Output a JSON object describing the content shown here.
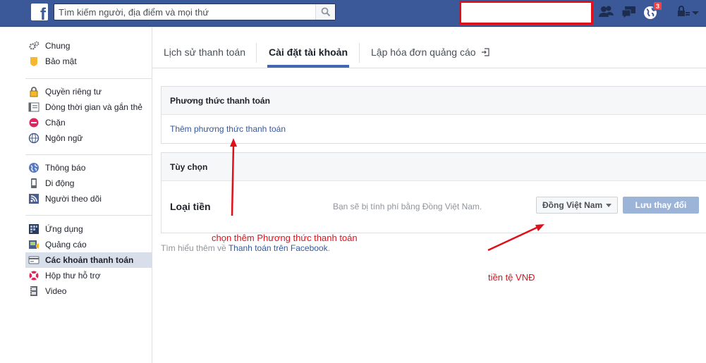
{
  "topbar": {
    "logo": "f",
    "search_placeholder": "Tìm kiếm người, địa điểm và mọi thứ",
    "notifications_badge": "3",
    "icons": [
      "friend-requests-icon",
      "messages-icon",
      "notifications-globe-icon",
      "privacy-shortcuts-icon",
      "account-menu-chevron-icon"
    ]
  },
  "leftnav": {
    "groups": [
      [
        {
          "label": "Chung",
          "icon": "gears-icon"
        },
        {
          "label": "Bảo mật",
          "icon": "shield-badge-icon"
        }
      ],
      [
        {
          "label": "Quyền riêng tư",
          "icon": "lock-icon"
        },
        {
          "label": "Dòng thời gian và gắn thẻ",
          "icon": "timeline-icon"
        },
        {
          "label": "Chặn",
          "icon": "block-icon"
        },
        {
          "label": "Ngôn ngữ",
          "icon": "globe-icon"
        }
      ],
      [
        {
          "label": "Thông báo",
          "icon": "globe-notifications-icon"
        },
        {
          "label": "Di động",
          "icon": "mobile-icon"
        },
        {
          "label": "Người theo dõi",
          "icon": "rss-icon"
        }
      ],
      [
        {
          "label": "Ứng dụng",
          "icon": "apps-grid-icon"
        },
        {
          "label": "Quảng cáo",
          "icon": "ads-icon"
        },
        {
          "label": "Các khoản thanh toán",
          "icon": "credit-card-icon"
        },
        {
          "label": "Hộp thư hỗ trợ",
          "icon": "lifebuoy-icon"
        },
        {
          "label": "Video",
          "icon": "film-icon"
        }
      ]
    ],
    "active": "Các khoản thanh toán"
  },
  "tabs": {
    "history": "Lịch sử thanh toán",
    "account_settings": "Cài đặt tài khoản",
    "ads_billing": "Lập hóa đơn quảng cáo"
  },
  "payment_methods": {
    "title": "Phương thức thanh toán",
    "add_link": "Thêm phương thức thanh toán"
  },
  "options": {
    "title": "Tùy chọn",
    "currency_label": "Loại tiền",
    "currency_note": "Bạn sẽ bị tính phí bằng Đồng Việt Nam.",
    "currency_selected": "Đồng Việt Nam",
    "save_label": "Lưu thay đổi"
  },
  "footer": {
    "prefix": "Tìm hiểu thêm về",
    "link": "Thanh toán trên Facebook",
    "suffix": "."
  },
  "annotations": {
    "add_payment": "chọn thêm Phương thức thanh toán",
    "currency": "tiền tệ VNĐ"
  },
  "colors": {
    "brand": "#3b5998",
    "link": "#365899",
    "annotation": "#e0101a",
    "save_disabled": "#9cb4d8"
  }
}
